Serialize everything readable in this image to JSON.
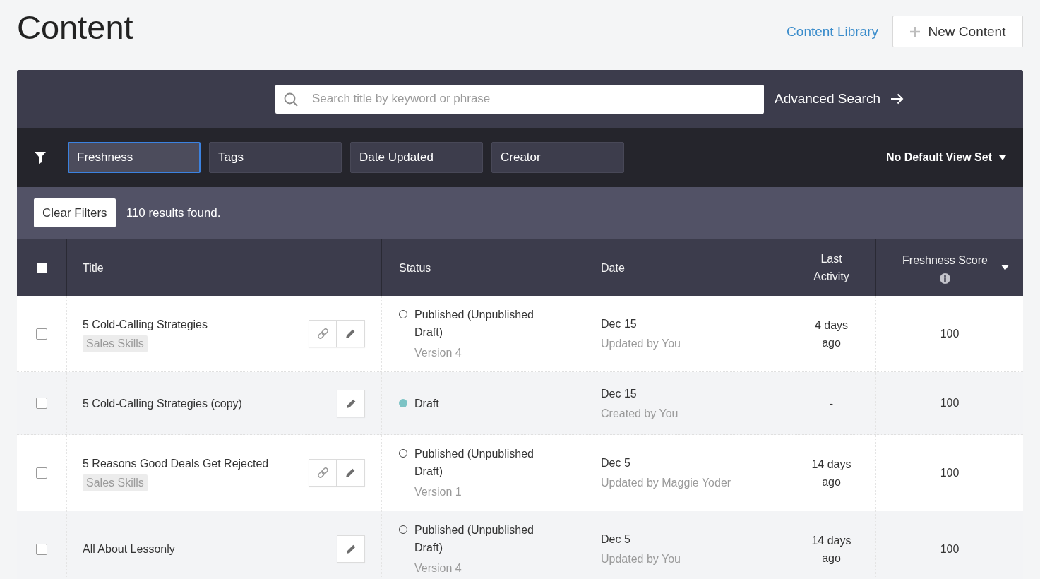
{
  "header": {
    "title": "Content",
    "library_link": "Content Library",
    "new_button": "New Content"
  },
  "search": {
    "placeholder": "Search title by keyword or phrase",
    "advanced_link": "Advanced Search"
  },
  "filters": [
    {
      "label": "Freshness",
      "selected": true
    },
    {
      "label": "Tags",
      "selected": false
    },
    {
      "label": "Date Updated",
      "selected": false
    },
    {
      "label": "Creator",
      "selected": false
    }
  ],
  "view_menu": {
    "label": "No Default View Set"
  },
  "results": {
    "clear_button": "Clear Filters",
    "count": "110 results found."
  },
  "table": {
    "select_all": {
      "checked": false
    },
    "columns": [
      {
        "label": "Title",
        "sorted": false,
        "info": false
      },
      {
        "label": "Status",
        "sorted": false,
        "info": false
      },
      {
        "label": "Date",
        "sorted": false,
        "info": false
      },
      {
        "label": "Last Activity",
        "sorted": false,
        "info": false
      },
      {
        "label": "Freshness Score",
        "sorted": true,
        "info": true
      }
    ],
    "rows": [
      {
        "checked": false,
        "title": "5 Cold-Calling Strategies",
        "tag": "Sales Skills",
        "link_button": true,
        "status": {
          "kind": "published",
          "label": "Published (Unpublished Draft)",
          "version": "Version 4"
        },
        "date": "Dec 15",
        "date_note": "Updated by You",
        "last_activity": "4 days ago",
        "freshness_score": "100"
      },
      {
        "checked": false,
        "title": "5 Cold-Calling Strategies (copy)",
        "link_button": false,
        "status": {
          "kind": "draft",
          "label": "Draft"
        },
        "date": "Dec 15",
        "date_note": "Created by You",
        "last_activity": "-",
        "freshness_score": "100"
      },
      {
        "checked": false,
        "title": "5 Reasons Good Deals Get Rejected",
        "tag": "Sales Skills",
        "link_button": true,
        "status": {
          "kind": "published",
          "label": "Published (Unpublished Draft)",
          "version": "Version 1"
        },
        "date": "Dec 5",
        "date_note": "Updated by Maggie Yoder",
        "last_activity": "14 days ago",
        "freshness_score": "100"
      },
      {
        "checked": false,
        "title": "All About Lessonly",
        "link_button": false,
        "status": {
          "kind": "published",
          "label": "Published (Unpublished Draft)",
          "version": "Version 4"
        },
        "date": "Dec 5",
        "date_note": "Updated by You",
        "last_activity": "14 days ago",
        "freshness_score": "100"
      }
    ]
  }
}
